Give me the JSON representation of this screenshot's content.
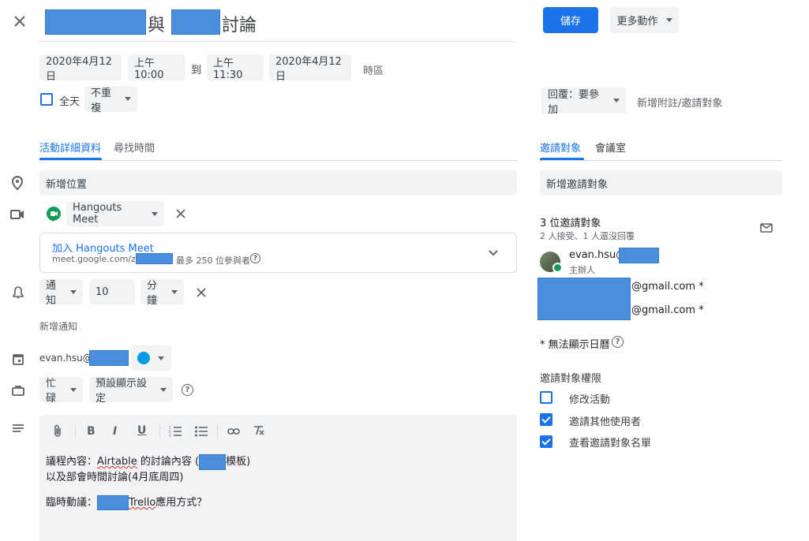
{
  "header": {
    "title_mid": "與",
    "title_end": "討論",
    "save_label": "儲存",
    "more_actions_label": "更多動作"
  },
  "datetime": {
    "start_date": "2020年4月12日",
    "start_time": "上午10:00",
    "to_label": "到",
    "end_time": "上午11:30",
    "end_date": "2020年4月12日",
    "timezone_label": "時區",
    "all_day_label": "全天",
    "repeat_label": "不重複"
  },
  "tabs_left": {
    "details": "活動詳細資料",
    "find_time": "尋找時間"
  },
  "location": {
    "placeholder": "新增位置"
  },
  "conference": {
    "name": "Hangouts Meet",
    "join_label": "加入 Hangouts Meet",
    "url_prefix": "meet.google.com/zky",
    "participants": "最多 250 位參與者"
  },
  "notification": {
    "type": "通知",
    "amount": "10",
    "unit": "分鐘",
    "add_label": "新增通知"
  },
  "calendar": {
    "owner_prefix": "evan.hsu@",
    "color": "#039be5"
  },
  "availability": {
    "busy_label": "忙碌",
    "visibility_label": "預設顯示設定"
  },
  "description": {
    "line1_prefix": "議程內容：",
    "line1_airtable": "Airtable",
    "line1_mid": " 的討論內容 (",
    "line1_suffix": "模板)",
    "line2": "以及部會時間討論(4月底周四)",
    "line3_prefix": "臨時動議：",
    "line3_trello": "Trello",
    "line3_suffix": "應用方式？"
  },
  "rsvp": {
    "label": "回覆：要參加",
    "add_note": "新增附註/邀請對象"
  },
  "tabs_right": {
    "guests": "邀請對象",
    "rooms": "會議室"
  },
  "guests": {
    "add_placeholder": "新增邀請對象",
    "count_label": "3 位邀請對象",
    "summary": "2 人接受、1 人還沒回覆",
    "organizer_prefix": "evan.hsu@",
    "organizer_role": "主辦人",
    "guest2_suffix": "@gmail.com *",
    "guest3_suffix": "@gmail.com *",
    "note": "* 無法顯示日曆"
  },
  "permissions": {
    "title": "邀請對象權限",
    "items": [
      {
        "label": "修改活動",
        "checked": false
      },
      {
        "label": "邀請其他使用者",
        "checked": true
      },
      {
        "label": "查看邀請對象名單",
        "checked": true
      }
    ]
  }
}
